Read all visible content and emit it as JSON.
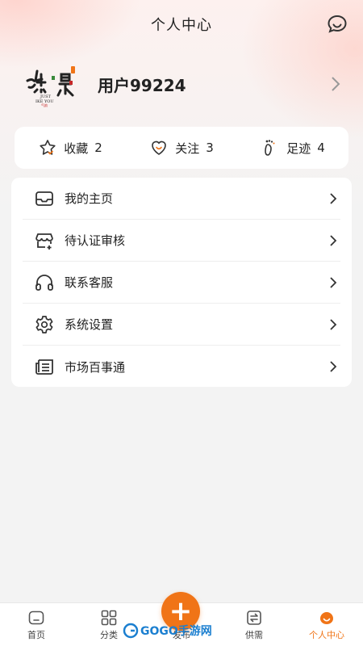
{
  "header": {
    "title": "个人中心",
    "chat_icon": "chat-bubble-icon"
  },
  "profile": {
    "username": "用户99224",
    "avatar_logo_text": "然是 JUST LIKE YOU"
  },
  "stats": [
    {
      "label": "收藏",
      "count": "2",
      "icon": "star-icon"
    },
    {
      "label": "关注",
      "count": "3",
      "icon": "heart-icon"
    },
    {
      "label": "足迹",
      "count": "4",
      "icon": "footprint-icon"
    }
  ],
  "menu": [
    {
      "label": "我的主页",
      "icon": "inbox-icon"
    },
    {
      "label": "待认证审核",
      "icon": "store-add-icon"
    },
    {
      "label": "联系客服",
      "icon": "headphones-icon"
    },
    {
      "label": "系统设置",
      "icon": "settings-icon"
    },
    {
      "label": "市场百事通",
      "icon": "newspaper-icon"
    }
  ],
  "tabbar": {
    "tabs": [
      {
        "label": "首页",
        "icon": "home-icon"
      },
      {
        "label": "分类",
        "icon": "grid-icon"
      },
      {
        "label": "发布",
        "icon": "plus-icon"
      },
      {
        "label": "供需",
        "icon": "exchange-icon"
      },
      {
        "label": "个人中心",
        "icon": "user-icon"
      }
    ],
    "active_index": 4
  },
  "watermark": {
    "text": "GOGO手游网"
  },
  "colors": {
    "accent": "#f07417",
    "background": "#f3f3f3",
    "card": "#ffffff"
  }
}
